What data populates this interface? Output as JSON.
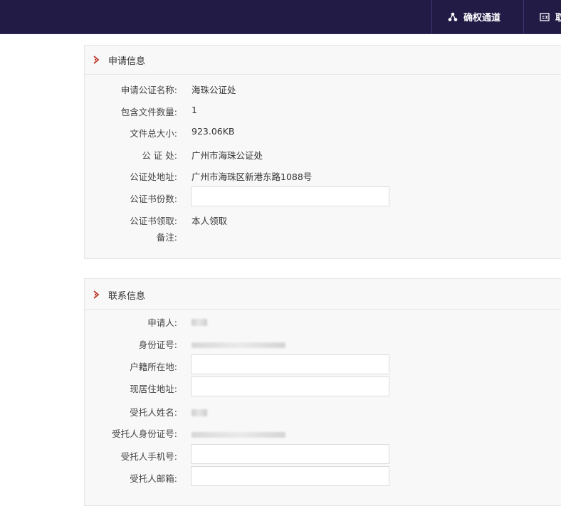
{
  "nav": {
    "items": [
      {
        "label": "确权通道",
        "icon": "share-nodes-icon"
      },
      {
        "label": "取",
        "icon": "id-card-icon"
      }
    ]
  },
  "application": {
    "title": "申请信息",
    "fields": [
      {
        "label": "申请公证名称:",
        "value": "海珠公证处"
      },
      {
        "label": "包含文件数量:",
        "value": "1"
      },
      {
        "label": "文件总大小:",
        "value": "923.06KB"
      },
      {
        "label": "公 证 处:",
        "value": "广州市海珠公证处"
      },
      {
        "label": "公证处地址:",
        "value": "广州市海珠区新港东路1088号"
      },
      {
        "label": "公证书份数:",
        "value": ""
      },
      {
        "label": "公证书领取:",
        "value": "本人领取"
      },
      {
        "label": "备注:",
        "value": ""
      }
    ]
  },
  "contact": {
    "title": "联系信息",
    "fields": [
      {
        "label": "申请人:",
        "value": ""
      },
      {
        "label": "身份证号:",
        "value": ""
      },
      {
        "label": "户籍所在地:",
        "value": ""
      },
      {
        "label": "现居住地址:",
        "value": ""
      },
      {
        "label": "受托人姓名:",
        "value": ""
      },
      {
        "label": "受托人身份证号:",
        "value": ""
      },
      {
        "label": "受托人手机号:",
        "value": ""
      },
      {
        "label": "受托人邮箱:",
        "value": ""
      }
    ]
  },
  "colors": {
    "topbar": "#221b46",
    "accent": "#c0392b"
  }
}
